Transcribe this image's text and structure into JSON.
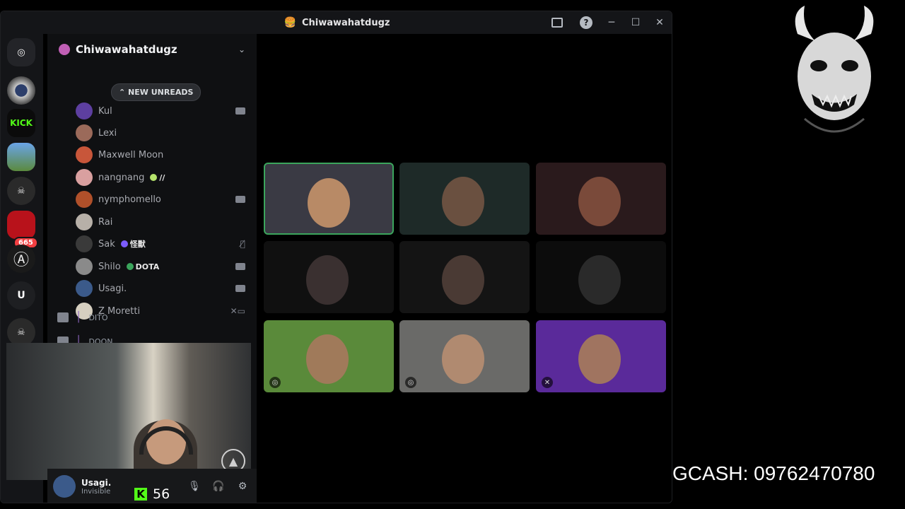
{
  "window": {
    "title": "Chiwawahatdugz",
    "title_emoji": "🍔"
  },
  "guilds": {
    "discord_label": "◎",
    "kick_label": "KICK",
    "red_badge": "665",
    "u_label": "U",
    "anarchy_label": "Ⓐ"
  },
  "server": {
    "name": "Chiwawahatdugz",
    "new_unreads": "NEW UNREADS"
  },
  "members": [
    {
      "name": "Kul",
      "tag": "",
      "icon": "video",
      "color": "#5d3fa0"
    },
    {
      "name": "Lexi",
      "tag": "",
      "icon": "",
      "color": "#9b6a5a"
    },
    {
      "name": "Maxwell Moon",
      "tag": "",
      "icon": "",
      "color": "#c8563a"
    },
    {
      "name": "nangnang",
      "tag": "//",
      "icon": "",
      "color": "#d9a0a0"
    },
    {
      "name": "nymphomello",
      "tag": "",
      "icon": "video",
      "color": "#b0502a"
    },
    {
      "name": "Rai",
      "tag": "",
      "icon": "",
      "color": "#b7b0a8"
    },
    {
      "name": "Sak",
      "tag": "怪獸",
      "icon": "mute",
      "color": "#3a3a3a"
    },
    {
      "name": "Shilo",
      "tag": "DOTA",
      "icon": "video",
      "color": "#8a8a8a"
    },
    {
      "name": "Usagi.",
      "tag": "",
      "icon": "video",
      "color": "#3b5a8a"
    },
    {
      "name": "Z Moretti",
      "tag": "",
      "icon": "mute-video",
      "color": "#d6cfc0"
    }
  ],
  "channels": [
    {
      "name": "DITO"
    },
    {
      "name": "DOON"
    }
  ],
  "user_panel": {
    "name": "Usagi.",
    "status": "Invisible"
  },
  "overlay": {
    "kick_count": "56",
    "gcash": "GCASH: 09762470780"
  },
  "tiles": [
    {
      "id": "tile-1",
      "active": true,
      "bg": "#3a3a44",
      "face": "#b88a66"
    },
    {
      "id": "tile-2",
      "active": false,
      "bg": "#1e2a28",
      "face": "#6a5040"
    },
    {
      "id": "tile-3",
      "active": false,
      "bg": "#2a1a1c",
      "face": "#7a4a3a"
    },
    {
      "id": "tile-4",
      "active": false,
      "bg": "#101010",
      "face": "#3a3030"
    },
    {
      "id": "tile-5",
      "active": false,
      "bg": "#141414",
      "face": "#4a3a34"
    },
    {
      "id": "tile-6",
      "active": false,
      "bg": "#0c0c0c",
      "face": "#2a2a2a"
    },
    {
      "id": "tile-7",
      "active": false,
      "bg": "#5a8a3a",
      "face": "#a07a5a"
    },
    {
      "id": "tile-8",
      "active": false,
      "bg": "#6a6a68",
      "face": "#b08a70"
    },
    {
      "id": "tile-9",
      "active": false,
      "bg": "#5a2a9a",
      "face": "#a07460"
    }
  ]
}
